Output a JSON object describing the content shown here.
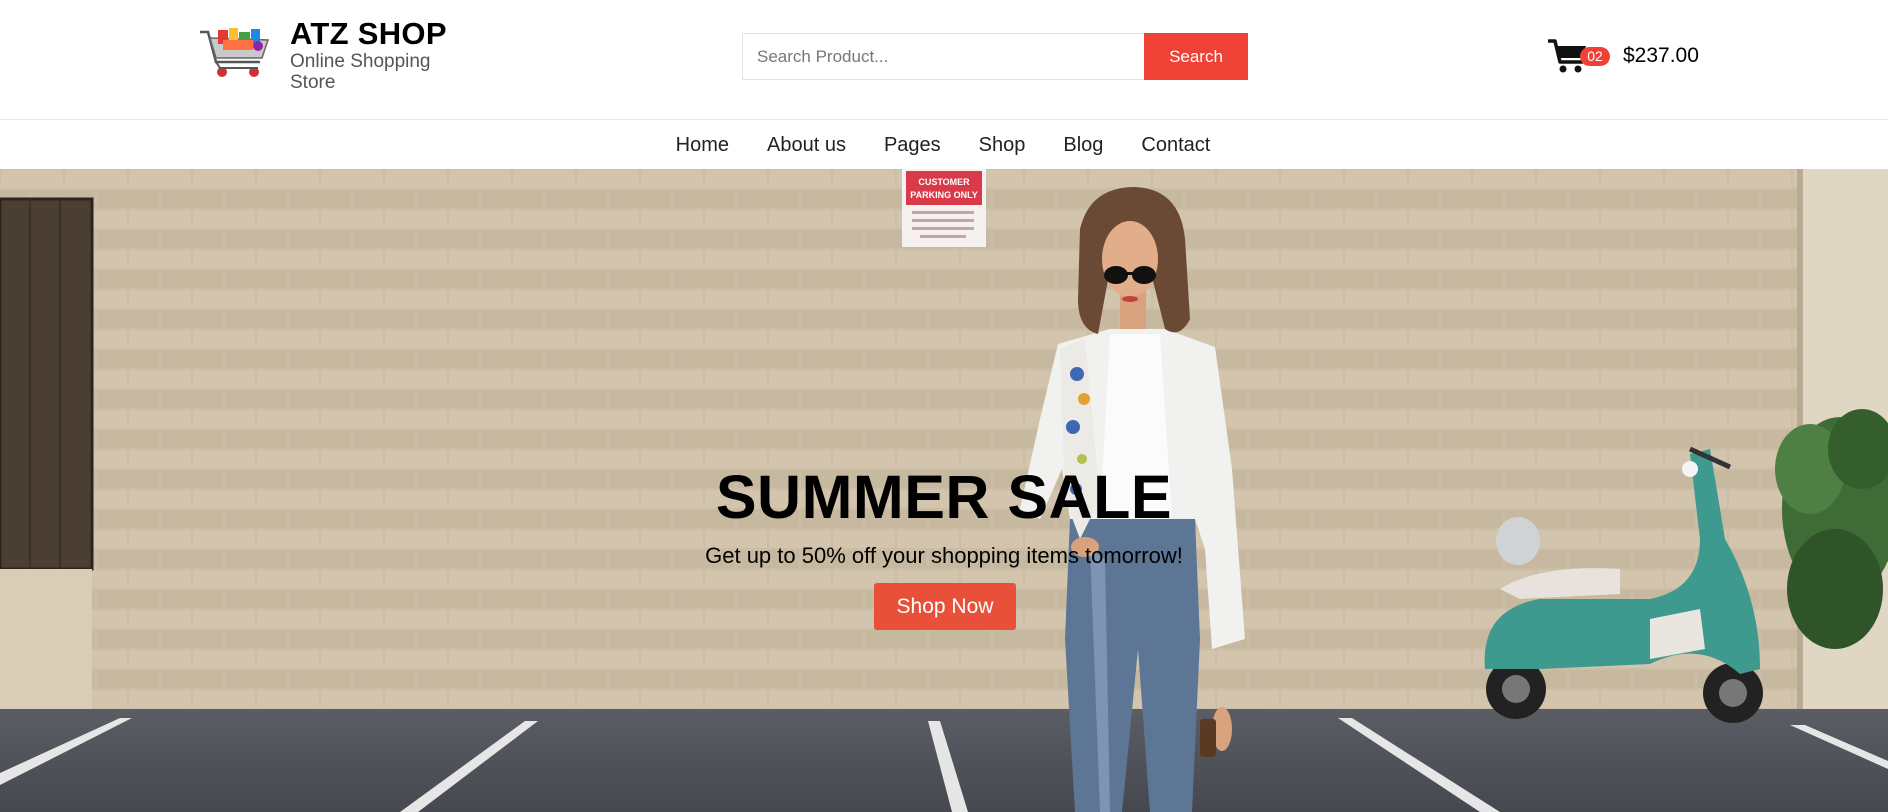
{
  "brand": {
    "name": "ATZ SHOP",
    "tagline": "Online Shopping Store"
  },
  "search": {
    "placeholder": "Search Product...",
    "button_label": "Search"
  },
  "cart": {
    "count": "02",
    "total": "$237.00"
  },
  "nav": {
    "items": [
      {
        "label": "Home"
      },
      {
        "label": "About us"
      },
      {
        "label": "Pages"
      },
      {
        "label": "Shop"
      },
      {
        "label": "Blog"
      },
      {
        "label": "Contact"
      }
    ]
  },
  "hero": {
    "title": "SUMMER SALE",
    "subtitle": "Get up to 50% off your shopping items tomorrow!",
    "button_label": "Shop Now",
    "sign_text": "CUSTOMER PARKING ONLY"
  },
  "colors": {
    "accent": "#ef4136",
    "hero_button": "#e8503a",
    "wall": "#cdbfa9",
    "asphalt": "#4f535a"
  }
}
